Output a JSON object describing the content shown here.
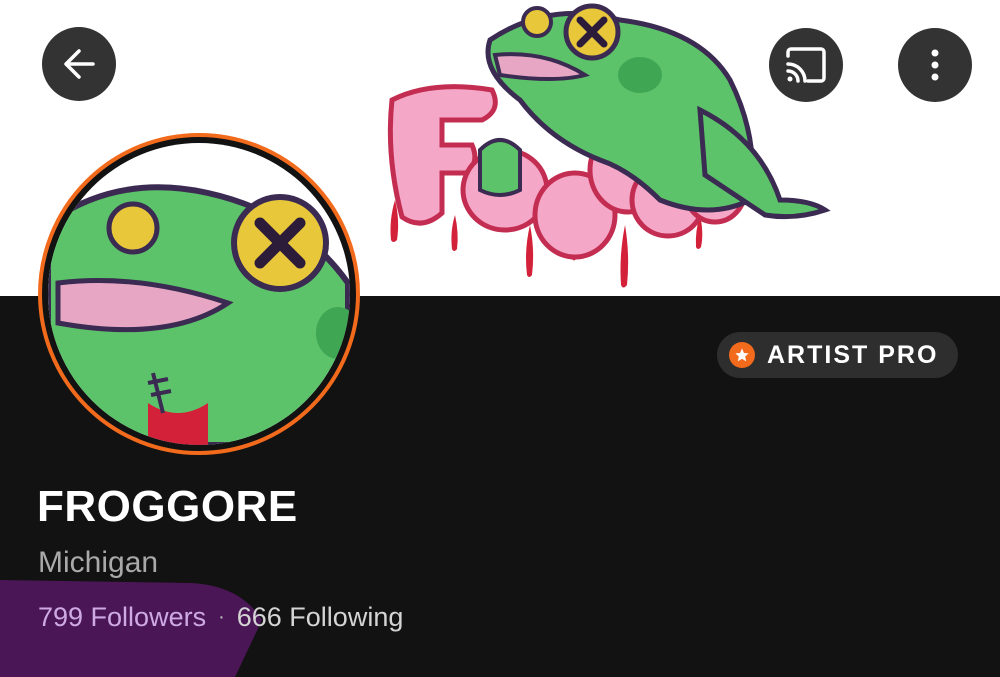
{
  "toolbar": {
    "back_icon": "arrow-left-icon",
    "cast_icon": "cast-icon",
    "more_icon": "more-vertical-icon"
  },
  "banner": {
    "art_text": "FrogGore"
  },
  "badge": {
    "label": "ARTIST PRO",
    "icon": "star-icon",
    "color": "#f26a1b"
  },
  "profile": {
    "name": "FROGGORE",
    "location": "Michigan",
    "followers": "799 Followers",
    "separator": "·",
    "following": "666 Following"
  },
  "colors": {
    "accent": "#f26a1b",
    "background": "#121212",
    "highlight": "#4a1656"
  }
}
